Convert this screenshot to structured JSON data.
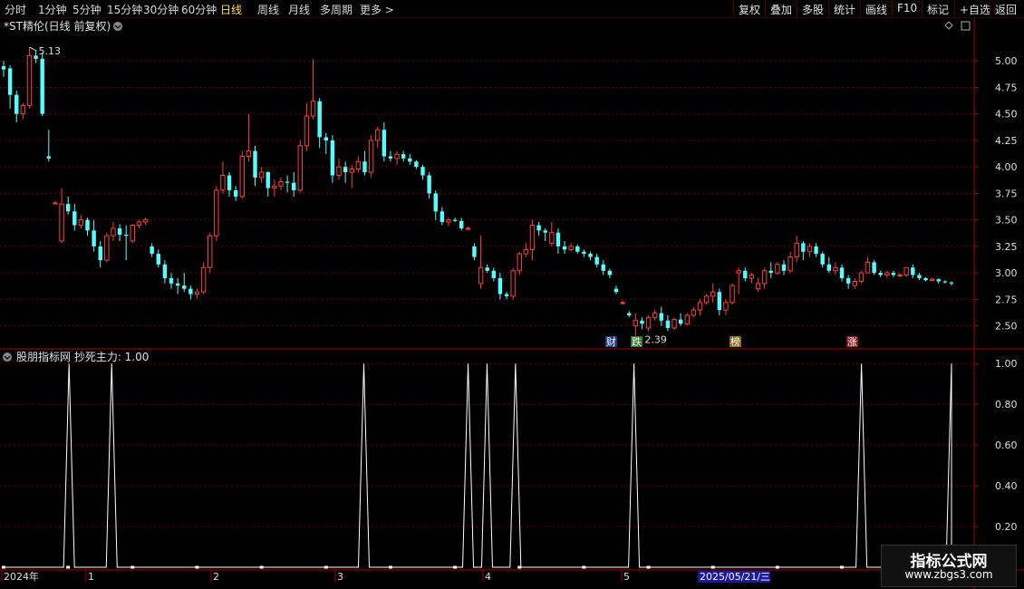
{
  "toolbar": {
    "periods": [
      "分时",
      "1分钟",
      "5分钟",
      "15分钟",
      "30分钟",
      "60分钟",
      "日线",
      "周线",
      "月线",
      "多周期",
      "更多 >"
    ],
    "active_period": "日线",
    "actions": [
      "复权",
      "叠加",
      "多股",
      "统计",
      "画线",
      "F10",
      "标记",
      "+自选",
      "返回"
    ]
  },
  "main_panel": {
    "title": "*ST精伦(日线 前复权)",
    "max_label": "5.13",
    "min_label": "2.39",
    "y_ticks": [
      "5.00",
      "4.75",
      "4.50",
      "4.25",
      "4.00",
      "3.75",
      "3.50",
      "3.25",
      "3.00",
      "2.75",
      "2.50"
    ],
    "markers": [
      {
        "text": "财",
        "color": "#ffffff",
        "bg": "#1a3a8a"
      },
      {
        "text": "跌",
        "color": "#ffffff",
        "bg": "#2a7a2a"
      },
      {
        "text": "榜",
        "color": "#ffffff",
        "bg": "#8a6a1a"
      },
      {
        "text": "涨",
        "color": "#ffffff",
        "bg": "#8a1a1a"
      }
    ]
  },
  "indicator_panel": {
    "title": "股朋指标网 抄死主力: 1.00",
    "y_ticks": [
      "1.00",
      "0.80",
      "0.60",
      "0.40",
      "0.20"
    ]
  },
  "date_axis": {
    "labels": [
      "2024年",
      "1",
      "2",
      "3",
      "4",
      "5"
    ],
    "cursor_date": "2025/05/21/三"
  },
  "watermark": {
    "line1": "指标公式网",
    "line2": "www.zbgs3.com"
  },
  "colors": {
    "up": "#ff3c3c",
    "down": "#54ffff",
    "grid": "#7a0000",
    "indicator": "#ffffff"
  },
  "chart_data": [
    {
      "type": "candlestick",
      "title": "*ST精伦(日线 前复权)",
      "ylim": [
        2.3,
        5.25
      ],
      "candles": [
        [
          4.95,
          5.0,
          4.85,
          4.92
        ],
        [
          4.93,
          4.96,
          4.55,
          4.68
        ],
        [
          4.68,
          4.72,
          4.42,
          4.5
        ],
        [
          4.5,
          4.6,
          4.45,
          4.58
        ],
        [
          4.58,
          5.13,
          4.55,
          5.05
        ],
        [
          5.05,
          5.1,
          4.98,
          5.02
        ],
        [
          5.02,
          5.08,
          4.48,
          4.5
        ],
        [
          4.1,
          4.35,
          4.05,
          4.08
        ],
        [
          3.66,
          3.68,
          3.65,
          3.66
        ],
        [
          3.3,
          3.8,
          3.28,
          3.65
        ],
        [
          3.65,
          3.72,
          3.55,
          3.58
        ],
        [
          3.58,
          3.65,
          3.4,
          3.45
        ],
        [
          3.45,
          3.55,
          3.42,
          3.5
        ],
        [
          3.5,
          3.52,
          3.35,
          3.4
        ],
        [
          3.4,
          3.5,
          3.2,
          3.25
        ],
        [
          3.25,
          3.3,
          3.05,
          3.12
        ],
        [
          3.12,
          3.38,
          3.1,
          3.35
        ],
        [
          3.35,
          3.48,
          3.3,
          3.42
        ],
        [
          3.42,
          3.46,
          3.3,
          3.36
        ],
        [
          3.36,
          3.45,
          3.12,
          3.35
        ],
        [
          3.3,
          3.46,
          3.28,
          3.45
        ],
        [
          3.45,
          3.5,
          3.42,
          3.48
        ],
        [
          3.48,
          3.52,
          3.45,
          3.5
        ],
        [
          3.25,
          3.28,
          3.15,
          3.18
        ],
        [
          3.18,
          3.22,
          3.05,
          3.08
        ],
        [
          3.08,
          3.12,
          2.9,
          2.95
        ],
        [
          2.95,
          3.0,
          2.85,
          2.9
        ],
        [
          2.9,
          2.95,
          2.8,
          2.88
        ],
        [
          2.88,
          3.0,
          2.82,
          2.85
        ],
        [
          2.85,
          2.88,
          2.75,
          2.8
        ],
        [
          2.8,
          2.85,
          2.76,
          2.82
        ],
        [
          2.82,
          3.1,
          2.8,
          3.05
        ],
        [
          3.05,
          3.38,
          3.0,
          3.35
        ],
        [
          3.35,
          3.82,
          3.3,
          3.78
        ],
        [
          3.78,
          4.05,
          3.75,
          3.92
        ],
        [
          3.92,
          3.95,
          3.72,
          3.78
        ],
        [
          3.78,
          3.82,
          3.68,
          3.72
        ],
        [
          3.72,
          4.15,
          3.7,
          4.1
        ],
        [
          4.1,
          4.5,
          4.05,
          4.15
        ],
        [
          4.15,
          4.2,
          3.82,
          3.9
        ],
        [
          3.9,
          4.0,
          3.85,
          3.95
        ],
        [
          3.95,
          3.96,
          3.72,
          3.8
        ],
        [
          3.8,
          3.88,
          3.72,
          3.82
        ],
        [
          3.82,
          3.9,
          3.78,
          3.86
        ],
        [
          3.86,
          3.92,
          3.76,
          3.85
        ],
        [
          3.85,
          3.95,
          3.72,
          3.78
        ],
        [
          3.78,
          4.25,
          3.76,
          4.2
        ],
        [
          4.2,
          4.6,
          4.15,
          4.48
        ],
        [
          4.48,
          5.02,
          4.45,
          4.62
        ],
        [
          4.62,
          4.65,
          4.18,
          4.28
        ],
        [
          4.28,
          4.32,
          4.12,
          4.25
        ],
        [
          4.25,
          4.3,
          3.85,
          3.92
        ],
        [
          3.92,
          4.08,
          3.88,
          4.0
        ],
        [
          4.0,
          4.05,
          3.85,
          3.95
        ],
        [
          3.95,
          4.02,
          3.8,
          3.98
        ],
        [
          3.98,
          4.1,
          3.95,
          4.05
        ],
        [
          4.05,
          4.15,
          3.92,
          3.95
        ],
        [
          3.95,
          4.3,
          3.9,
          4.25
        ],
        [
          4.25,
          4.38,
          4.18,
          4.35
        ],
        [
          4.35,
          4.42,
          4.05,
          4.1
        ],
        [
          4.1,
          4.15,
          4.05,
          4.08
        ],
        [
          4.08,
          4.15,
          4.02,
          4.12
        ],
        [
          4.12,
          4.15,
          4.05,
          4.08
        ],
        [
          4.08,
          4.12,
          4.02,
          4.05
        ],
        [
          4.05,
          4.06,
          3.98,
          4.0
        ],
        [
          4.0,
          4.02,
          3.88,
          3.92
        ],
        [
          3.92,
          3.95,
          3.7,
          3.75
        ],
        [
          3.75,
          3.78,
          3.5,
          3.58
        ],
        [
          3.58,
          3.62,
          3.45,
          3.48
        ],
        [
          3.48,
          3.52,
          3.44,
          3.5
        ],
        [
          3.5,
          3.52,
          3.48,
          3.49
        ],
        [
          3.49,
          3.52,
          3.4,
          3.42
        ],
        [
          3.42,
          3.44,
          3.4,
          3.42
        ],
        [
          3.25,
          3.28,
          3.12,
          3.15
        ],
        [
          2.9,
          3.35,
          2.85,
          3.05
        ],
        [
          3.05,
          3.08,
          3.0,
          3.02
        ],
        [
          3.02,
          3.05,
          2.92,
          2.95
        ],
        [
          2.95,
          3.0,
          2.75,
          2.8
        ],
        [
          2.8,
          2.82,
          2.75,
          2.78
        ],
        [
          2.78,
          3.05,
          2.75,
          3.02
        ],
        [
          3.02,
          3.2,
          2.98,
          3.18
        ],
        [
          3.18,
          3.28,
          3.15,
          3.22
        ],
        [
          3.22,
          3.5,
          3.12,
          3.45
        ],
        [
          3.45,
          3.48,
          3.35,
          3.4
        ],
        [
          3.4,
          3.42,
          3.3,
          3.38
        ],
        [
          3.28,
          3.48,
          3.25,
          3.38
        ],
        [
          3.38,
          3.42,
          3.18,
          3.25
        ],
        [
          3.25,
          3.3,
          3.18,
          3.22
        ],
        [
          3.22,
          3.28,
          3.2,
          3.25
        ],
        [
          3.25,
          3.27,
          3.18,
          3.2
        ],
        [
          3.2,
          3.22,
          3.15,
          3.18
        ],
        [
          3.18,
          3.2,
          3.12,
          3.15
        ],
        [
          3.15,
          3.18,
          3.05,
          3.08
        ],
        [
          3.08,
          3.12,
          2.98,
          3.02
        ],
        [
          3.02,
          3.04,
          2.95,
          2.98
        ],
        [
          2.85,
          2.88,
          2.8,
          2.82
        ],
        [
          2.72,
          2.74,
          2.7,
          2.72
        ],
        [
          2.62,
          2.64,
          2.58,
          2.6
        ],
        [
          2.5,
          2.62,
          2.39,
          2.55
        ],
        [
          2.55,
          2.58,
          2.47,
          2.52
        ],
        [
          2.48,
          2.6,
          2.45,
          2.58
        ],
        [
          2.58,
          2.65,
          2.55,
          2.62
        ],
        [
          2.62,
          2.68,
          2.5,
          2.55
        ],
        [
          2.55,
          2.6,
          2.45,
          2.48
        ],
        [
          2.48,
          2.58,
          2.46,
          2.56
        ],
        [
          2.56,
          2.62,
          2.5,
          2.52
        ],
        [
          2.52,
          2.62,
          2.5,
          2.6
        ],
        [
          2.6,
          2.68,
          2.58,
          2.65
        ],
        [
          2.65,
          2.75,
          2.6,
          2.72
        ],
        [
          2.72,
          2.8,
          2.7,
          2.78
        ],
        [
          2.78,
          2.9,
          2.72,
          2.82
        ],
        [
          2.82,
          2.85,
          2.6,
          2.65
        ],
        [
          2.65,
          2.75,
          2.6,
          2.72
        ],
        [
          2.72,
          2.9,
          2.7,
          2.88
        ],
        [
          3.0,
          3.05,
          2.8,
          3.02
        ],
        [
          3.02,
          3.05,
          2.92,
          2.95
        ],
        [
          2.95,
          3.0,
          2.9,
          2.98
        ],
        [
          2.85,
          2.95,
          2.82,
          2.9
        ],
        [
          2.9,
          3.05,
          2.85,
          3.02
        ],
        [
          3.02,
          3.1,
          2.95,
          3.0
        ],
        [
          3.0,
          3.1,
          2.98,
          3.08
        ],
        [
          3.08,
          3.12,
          2.98,
          3.02
        ],
        [
          3.02,
          3.2,
          3.0,
          3.15
        ],
        [
          3.15,
          3.35,
          3.1,
          3.28
        ],
        [
          3.28,
          3.3,
          3.12,
          3.2
        ],
        [
          3.2,
          3.28,
          3.15,
          3.25
        ],
        [
          3.25,
          3.28,
          3.15,
          3.18
        ],
        [
          3.18,
          3.2,
          3.05,
          3.08
        ],
        [
          3.08,
          3.15,
          3.0,
          3.02
        ],
        [
          3.02,
          3.1,
          2.98,
          3.05
        ],
        [
          3.05,
          3.08,
          2.92,
          2.95
        ],
        [
          2.95,
          2.98,
          2.85,
          2.9
        ],
        [
          2.88,
          2.95,
          2.85,
          2.92
        ],
        [
          2.92,
          3.02,
          2.9,
          3.0
        ],
        [
          3.0,
          3.15,
          3.0,
          3.1
        ],
        [
          3.1,
          3.12,
          2.98,
          3.0
        ],
        [
          3.0,
          3.02,
          2.96,
          2.98
        ],
        [
          2.98,
          3.02,
          2.95,
          3.0
        ],
        [
          3.0,
          3.02,
          2.96,
          2.98
        ],
        [
          2.98,
          3.0,
          2.96,
          2.98
        ],
        [
          2.98,
          3.05,
          2.96,
          3.05
        ],
        [
          3.05,
          3.08,
          2.95,
          2.98
        ],
        [
          2.98,
          3.0,
          2.93,
          2.95
        ],
        [
          2.95,
          2.96,
          2.92,
          2.93
        ],
        [
          2.93,
          2.95,
          2.92,
          2.94
        ],
        [
          2.94,
          2.95,
          2.9,
          2.92
        ],
        [
          2.92,
          2.93,
          2.9,
          2.91
        ],
        [
          2.91,
          2.92,
          2.88,
          2.9
        ]
      ]
    },
    {
      "type": "line",
      "title": "股朋指标网 抄死主力",
      "ylim": [
        0,
        1.05
      ],
      "spike_x_fractions": [
        0.069,
        0.114,
        0.38,
        0.49,
        0.51,
        0.54,
        0.665,
        0.905,
        1.0
      ],
      "values_note_levels": [
        0,
        1
      ]
    }
  ]
}
